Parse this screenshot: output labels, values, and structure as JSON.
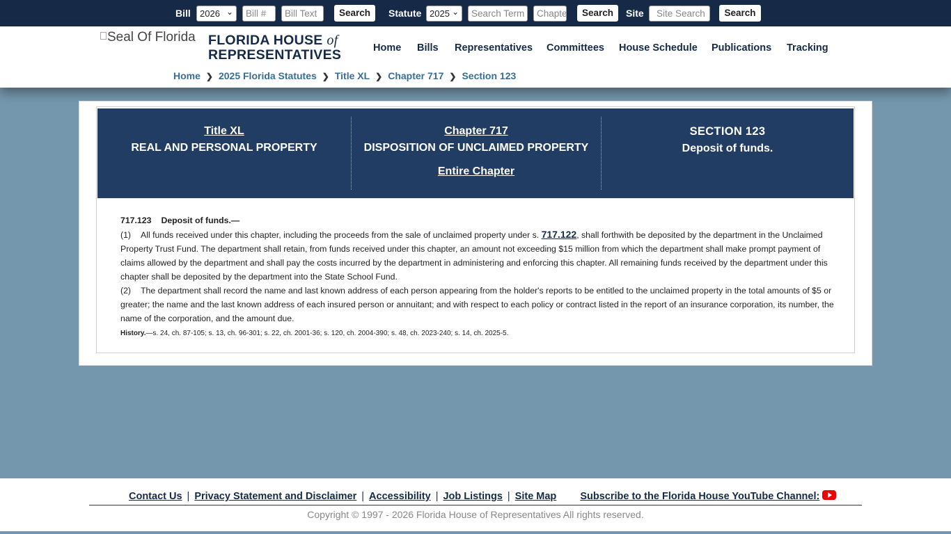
{
  "topbar": {
    "bill_label": "Bill",
    "bill_year": "2026",
    "bill_number_placeholder": "Bill #",
    "bill_text_placeholder": "Bill Text",
    "bill_search_label": "Search",
    "statute_label": "Statute",
    "statute_year": "2025",
    "search_term_placeholder": "Search Term",
    "chapter_placeholder": "Chapter",
    "statute_search_label": "Search",
    "site_label": "Site",
    "site_search_placeholder": "Site Search",
    "site_search_button": "Search"
  },
  "header": {
    "seal_alt": "Seal Of Florida",
    "brand_line1_a": "FLORIDA HOUSE ",
    "brand_line1_b": "of",
    "brand_line2": "REPRESENTATIVES",
    "nav": [
      "Home",
      "Bills",
      "Representatives",
      "Committees",
      "House Schedule",
      "Publications",
      "Tracking"
    ],
    "breadcrumbs": [
      "Home",
      "2025 Florida Statutes",
      "Title XL",
      "Chapter 717",
      "Section 123"
    ]
  },
  "banner": {
    "title_link": "Title XL",
    "title_name": "REAL AND PERSONAL PROPERTY",
    "chapter_link": "Chapter 717",
    "chapter_name": "DISPOSITION OF UNCLAIMED PROPERTY",
    "entire_chapter": "Entire Chapter",
    "section_label": "SECTION 123",
    "section_name": "Deposit of funds."
  },
  "statute": {
    "number": "717.123",
    "catchline": "Deposit of funds.—",
    "sub1_num": "(1)",
    "sub1_text_a": "All funds received under this chapter, including the proceeds from the sale of unclaimed property under s. ",
    "sub1_link": "717.122",
    "sub1_text_b": ", shall forthwith be deposited by the department in the Unclaimed Property Trust Fund. The department shall retain, from funds received under this chapter, an amount not exceeding $15 million from which the department shall make prompt payment of claims allowed by the department and shall pay the costs incurred by the department in administering and enforcing this chapter. All remaining funds received by the department under this chapter shall be deposited by the department into the State School Fund.",
    "sub2_num": "(2)",
    "sub2_text": "The department shall record the name and last known address of each person appearing from the holder's reports to be entitled to the unclaimed property in the total amounts of $5 or greater; the name and the last known address of each insured person or annuitant; and with respect to each policy or contract listed in the report of an insurance corporation, its number, the name of the corporation, and the amount due.",
    "history_label": "History.",
    "history_text": "—s. 24, ch. 87-105; s. 13, ch. 96-301; s. 22, ch. 2001-36; s. 120, ch. 2004-390; s. 48, ch. 2023-240; s. 14, ch. 2025-5."
  },
  "footer": {
    "links": [
      "Contact Us",
      "Privacy Statement and Disclaimer",
      "Accessibility",
      "Job Listings",
      "Site Map"
    ],
    "youtube": "Subscribe to the Florida House YouTube Channel:",
    "copyright": "Copyright © 1997 - 2026 Florida House of Representatives All rights reserved."
  },
  "icons": {
    "youtube": "youtube-icon",
    "select_arrow": "chevron-down-icon",
    "breadcrumb_sep": "chevron-right-icon",
    "seal": "broken-image-icon"
  },
  "colors": {
    "topbar": "#162a48",
    "banner": "#223d63",
    "page_bg": "#7597ad",
    "link": "#3a6d96",
    "youtube": "#ee0000"
  }
}
